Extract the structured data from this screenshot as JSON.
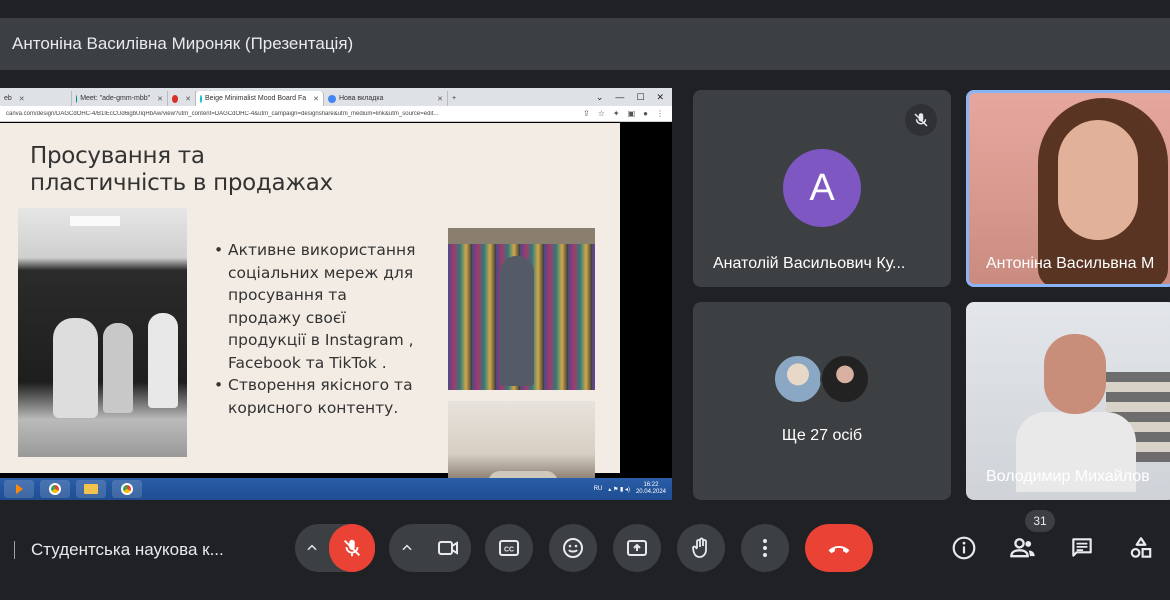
{
  "header": {
    "title": "Антоніна Василівна Мироняк (Презентація)"
  },
  "browser": {
    "tabs": [
      {
        "label": "eb",
        "active": false
      },
      {
        "label": "Meet: \"ade-gmm-mbb\"",
        "active": false
      },
      {
        "label": "",
        "active": false
      },
      {
        "label": "Beige Minimalist Mood Board Fa",
        "active": true
      },
      {
        "label": "Нова вкладка",
        "active": false
      }
    ],
    "url": "canva.com/design/DAGCdOHC-4/B1lEcCUd6igbUIqHbAw/view?utm_content=DAGCdOHC-4&utm_campaign=designshare&utm_medium=link&utm_source=edit..."
  },
  "slide": {
    "title_line1": "Просування та",
    "title_line2": "пластичність в продажах",
    "bullets": [
      "Активне  використання соціальних мереж для просування та продажу своєї продукції в Instagram , Facebook та TikTok .",
      "Створення якісного та корисного контенту."
    ]
  },
  "taskbar": {
    "lang": "RU",
    "time": "16:22",
    "date": "20.04.2024"
  },
  "participants": {
    "tile1": {
      "initial": "A",
      "name": "Анатолій Васильович Ку...",
      "avatar_color": "#7e57c2"
    },
    "tile2": {
      "name": "Антоніна Васильвна М"
    },
    "tile3": {
      "label": "Ще 27 осіб"
    },
    "tile4": {
      "name": "Володимир Михайлов"
    }
  },
  "bottombar": {
    "meeting_name": "Студентська наукова к...",
    "participant_count": "31",
    "end_call_color": "#ea4335",
    "mic_muted_color": "#ea4335"
  }
}
